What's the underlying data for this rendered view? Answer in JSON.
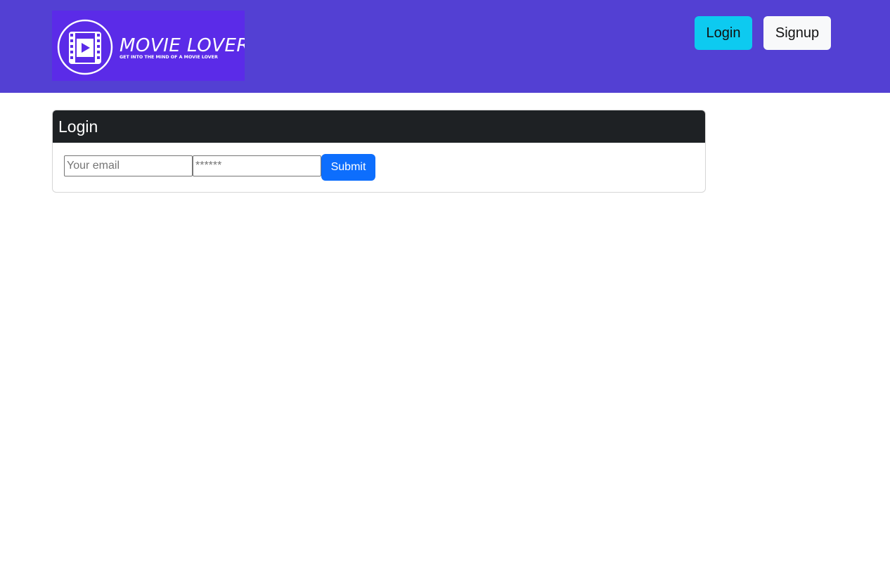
{
  "header": {
    "logo": {
      "title": "MOVIE LOVER",
      "tagline": "GET INTO THE MIND OF A MOVIE LOVER",
      "icon": "film-play-icon"
    },
    "nav": {
      "login_label": "Login",
      "signup_label": "Signup"
    }
  },
  "login_card": {
    "title": "Login",
    "email_placeholder": "Your email",
    "password_placeholder": "******",
    "submit_label": "Submit"
  },
  "colors": {
    "navbar": "#5340d3",
    "logo_bg": "#5b2be8",
    "login_btn": "#0dcaf0",
    "signup_btn": "#f8f9fa",
    "card_header": "#1e2124",
    "submit_btn": "#0d6efd"
  }
}
